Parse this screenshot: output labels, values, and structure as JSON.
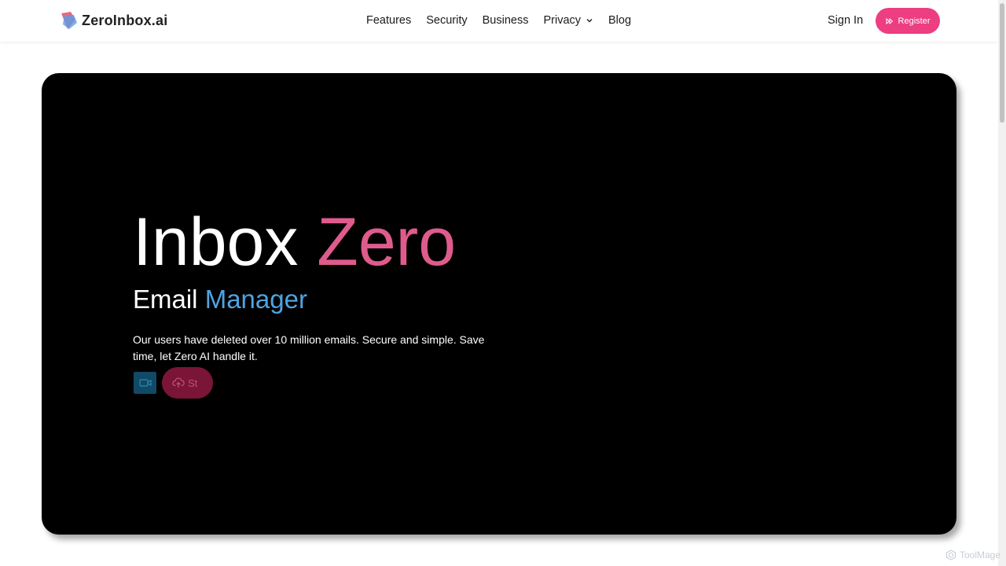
{
  "brand": {
    "name": "ZeroInbox.ai",
    "logo_icon": "zeroinbox-logo-icon"
  },
  "nav": {
    "items": [
      {
        "label": "Features"
      },
      {
        "label": "Security"
      },
      {
        "label": "Business"
      },
      {
        "label": "Privacy",
        "has_dropdown": true
      },
      {
        "label": "Blog"
      }
    ],
    "sign_in": "Sign In",
    "register": "Register",
    "register_icon": "fast-forward-icon"
  },
  "hero": {
    "title_main": "Inbox",
    "title_accent": "Zero",
    "subtitle_main": "Email",
    "subtitle_accent": "Manager",
    "description": "Our users have deleted over 10 million emails. Secure and simple. Save time, let Zero AI handle it.",
    "video_button_icon": "video-camera-icon",
    "upload_button_icon": "cloud-upload-icon",
    "upload_button_label": "St"
  },
  "watermark": {
    "text": "ToolMage"
  },
  "colors": {
    "accent_pink": "#ec3e80",
    "title_pink": "#df5b8c",
    "subtitle_blue": "#4fa3e0",
    "hero_background": "#000000"
  }
}
